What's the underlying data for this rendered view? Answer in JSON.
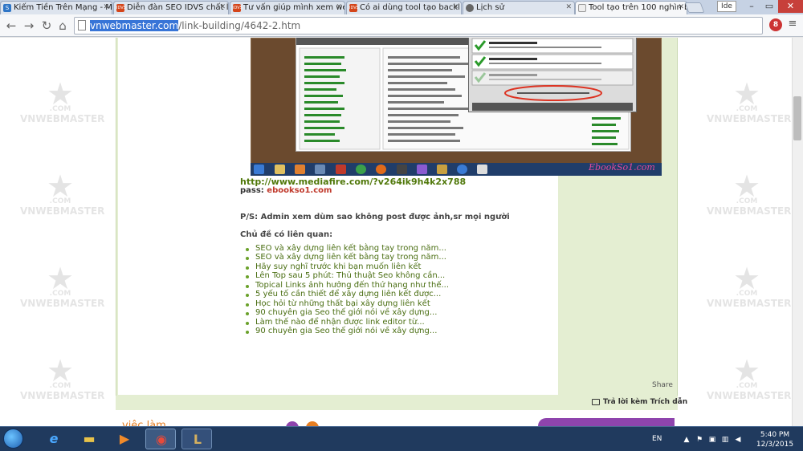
{
  "tabs": [
    {
      "label": "Kiếm Tiền Trên Mạng - M",
      "favicon": "S"
    },
    {
      "label": "Diễn đàn SEO IDVS chất lượ",
      "favicon": "IDVS"
    },
    {
      "label": "Tư vấn giúp mình xem web",
      "favicon": "IDVS"
    },
    {
      "label": "Có ai dùng tool tạo backl",
      "favicon": "IDVS"
    },
    {
      "label": "Lịch sử",
      "favicon": "history-icon"
    },
    {
      "label": "Tool tạo trên 100 nghìn b",
      "favicon": "web"
    }
  ],
  "window": {
    "profile": "Ide",
    "minimize": "–",
    "maximize": "▭",
    "close": "✕"
  },
  "nav": {
    "back": "←",
    "forward": "→",
    "reload": "↻",
    "home": "⌂"
  },
  "address": {
    "domain": "vnwebmaster.com",
    "path": "/link-building/4642-2.htm"
  },
  "extensions": {
    "ext_label": "8"
  },
  "watermark": {
    "com": ".COM",
    "brand": "VNWEBMASTER"
  },
  "screenshot": {
    "brand": "EbookSo1.com"
  },
  "post": {
    "download_link": "http://www.mediafire.com/?v264ik9h4k2x788",
    "pass_label": "pass: ",
    "pass_value": "ebookso1.com",
    "ps_text": "P/S: Admin xem dùm sao không post được ảnh,sr mọi người",
    "related_heading": "Chủ đề có liên quan:",
    "related": [
      "SEO và xây dựng liên kết bằng tay trong năm...",
      "SEO và xây dựng liên kết bằng tay trong năm...",
      "Hãy suy nghĩ trước khi bạn muốn liên kết",
      "Lên Top sau 5 phút: Thủ thuật Seo không cần...",
      "Topical Links ảnh hưởng đến thứ hạng như thế...",
      "5 yếu tố cần thiết để xây dựng liên kết được...",
      "Học hỏi từ những thất bại xây dựng liên kết",
      "90 chuyên gia Seo thế giới nói về xây dựng...",
      "Làm thế nào để nhận được link editor từ...",
      "90 chuyên gia Seo thế giới nói về xây dựng..."
    ],
    "share": "Share",
    "reply": "Trả lời kèm Trích dẫn"
  },
  "footer_preview": {
    "text": "việc làm"
  },
  "taskbar": {
    "lang": "EN",
    "time": "5:40 PM",
    "date": "12/3/2015",
    "apps": [
      "ie",
      "explorer",
      "media-player",
      "chrome",
      "league-of-legends"
    ]
  },
  "colors": {
    "post_bg": "#e4eed2",
    "link_green": "#4a6e12",
    "taskbar": "#203a5e"
  }
}
